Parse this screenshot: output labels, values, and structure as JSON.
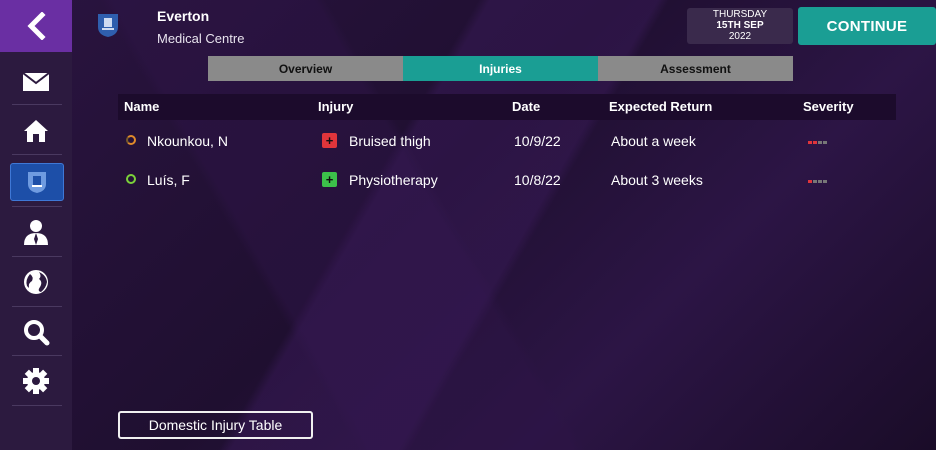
{
  "header": {
    "club_name": "Everton",
    "section": "Medical Centre",
    "date_day": "THURSDAY",
    "date_main": "15TH SEP",
    "date_year": "2022",
    "continue_label": "CONTINUE"
  },
  "sidebar": {
    "items": [
      {
        "icon": "back-icon"
      },
      {
        "icon": "mail-icon"
      },
      {
        "icon": "home-icon"
      },
      {
        "icon": "club-crest-icon",
        "active": true
      },
      {
        "icon": "person-icon"
      },
      {
        "icon": "globe-icon"
      },
      {
        "icon": "search-icon"
      },
      {
        "icon": "settings-gear-icon"
      }
    ]
  },
  "tabs": [
    {
      "label": "Overview"
    },
    {
      "label": "Injuries",
      "active": true
    },
    {
      "label": "Assessment"
    }
  ],
  "table": {
    "columns": [
      "Name",
      "Injury",
      "Date",
      "Expected Return",
      "Severity"
    ],
    "rows": [
      {
        "name": "Nkounkou, N",
        "injury": "Bruised thigh",
        "injury_type": "injury",
        "date": "10/9/22",
        "expected_return": "About a week",
        "severity_level": 2
      },
      {
        "name": "Luís, F",
        "injury": "Physiotherapy",
        "injury_type": "physio",
        "date": "10/8/22",
        "expected_return": "About 3 weeks",
        "severity_level": 1
      }
    ]
  },
  "footer": {
    "button_label": "Domestic Injury Table"
  },
  "colors": {
    "accent": "#1a9e94",
    "injury_red": "#e0353b",
    "physio_green": "#3cc04a",
    "severity_red": "#e0353b"
  }
}
